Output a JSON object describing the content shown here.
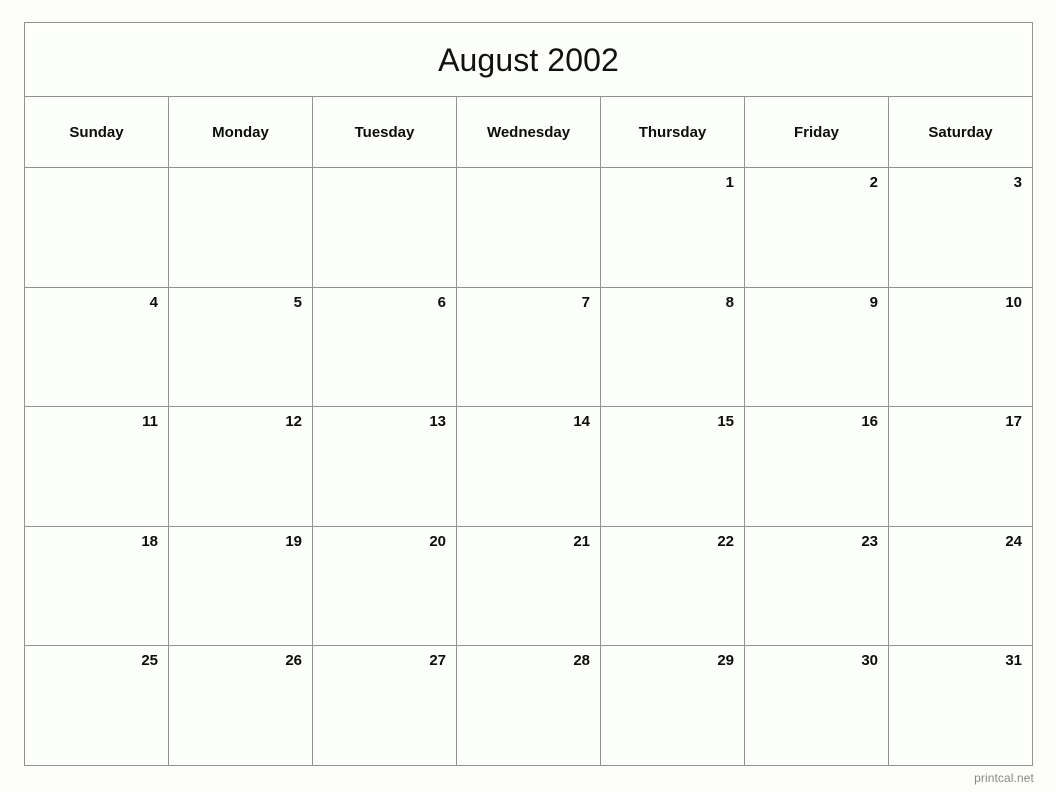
{
  "calendar": {
    "title": "August 2002",
    "month": "August",
    "year": "2002",
    "weekday_headers": [
      "Sunday",
      "Monday",
      "Tuesday",
      "Wednesday",
      "Thursday",
      "Friday",
      "Saturday"
    ],
    "weeks": [
      [
        "",
        "",
        "",
        "",
        "1",
        "2",
        "3"
      ],
      [
        "4",
        "5",
        "6",
        "7",
        "8",
        "9",
        "10"
      ],
      [
        "11",
        "12",
        "13",
        "14",
        "15",
        "16",
        "17"
      ],
      [
        "18",
        "19",
        "20",
        "21",
        "22",
        "23",
        "24"
      ],
      [
        "25",
        "26",
        "27",
        "28",
        "29",
        "30",
        "31"
      ]
    ],
    "first_day_of_week": "Sunday",
    "first_weekday_of_month": "Thursday",
    "days_in_month": "31"
  },
  "footer": {
    "watermark": "printcal.net"
  },
  "colors": {
    "page_background": "#fcfdfa",
    "cell_background": "#fcfffa",
    "grid_line": "#8f948c",
    "text": "#0d0d0d",
    "title_text": "#111111",
    "watermark_text": "#8a8a8a"
  }
}
